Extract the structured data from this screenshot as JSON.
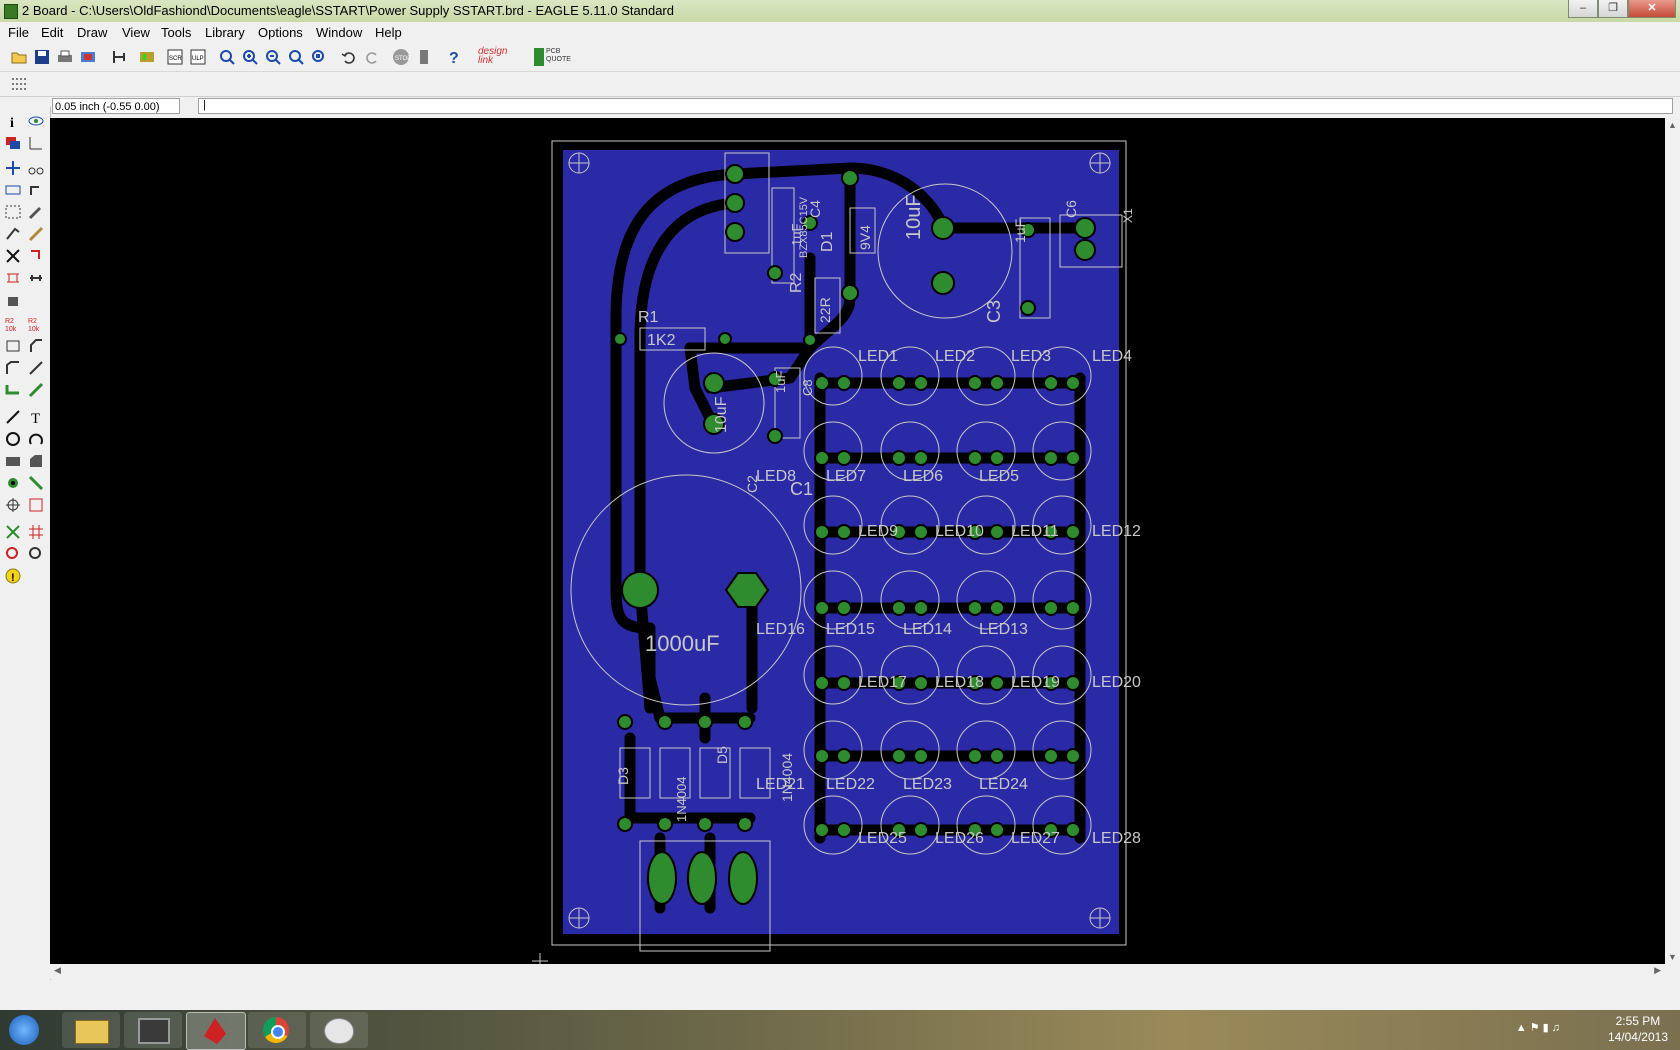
{
  "window": {
    "title": "2 Board - C:\\Users\\OldFashiond\\Documents\\eagle\\SSTART\\Power Supply SSTART.brd - EAGLE 5.11.0 Standard"
  },
  "menu": [
    "File",
    "Edit",
    "Draw",
    "View",
    "Tools",
    "Library",
    "Options",
    "Window",
    "Help"
  ],
  "toolbar": {
    "icons": [
      "open-icon",
      "save-icon",
      "print-icon",
      "cam-icon",
      "board-schematic-icon",
      "library-icon",
      "script-icon",
      "ulp-icon",
      "zoom-fit-icon",
      "zoom-in-icon",
      "zoom-out-icon",
      "zoom-redraw-icon",
      "zoom-select-icon",
      "undo-icon",
      "redo-icon",
      "stop-icon",
      "go-icon",
      "help-icon",
      "designlink-icon",
      "pcb-quote-icon"
    ],
    "designlink_label": "design link",
    "pcbquote_label": "PCB QUOTE"
  },
  "command": {
    "coordinates": "0.05 inch (-0.55 0.00)",
    "input_value": "|"
  },
  "board": {
    "labels": {
      "r1": "R1",
      "r1_value": "1K2",
      "r2": "R2",
      "r2_value": "22R",
      "c1": "C1",
      "c2": "C2",
      "c3": "C3",
      "c4": "C4",
      "c6": "C6",
      "c8": "C8",
      "d1": "D1",
      "d1_value": "9V4",
      "d3": "D3",
      "d5": "D5",
      "cap_10uf": "10uF",
      "cap_1uf": "1uF",
      "cap_1000uf": "1000uF",
      "diode_1n4004": "1N4004",
      "x1": "X1",
      "bzx": "BZX85C15V",
      "diode_top": "1N4004"
    },
    "leds": [
      "LED1",
      "LED2",
      "LED3",
      "LED4",
      "LED8",
      "LED7",
      "LED6",
      "LED5",
      "LED9",
      "LED10",
      "LED11",
      "LED12",
      "LED16",
      "LED15",
      "LED14",
      "LED13",
      "LED17",
      "LED18",
      "LED19",
      "LED20",
      "LED21",
      "LED22",
      "LED23",
      "LED24",
      "LED25",
      "LED26",
      "LED27",
      "LED28"
    ]
  },
  "taskbar": {
    "apps": [
      "start-icon",
      "explorer-icon",
      "sysmon-icon",
      "eagle-icon",
      "chrome-icon",
      "paint-icon"
    ],
    "time": "2:55 PM",
    "date": "14/04/2013"
  },
  "colors": {
    "board": "#2a2aa6",
    "copper": "#000000",
    "pad": "#2e8b2e",
    "silk": "#c8c8c8",
    "canvas": "#000000"
  }
}
